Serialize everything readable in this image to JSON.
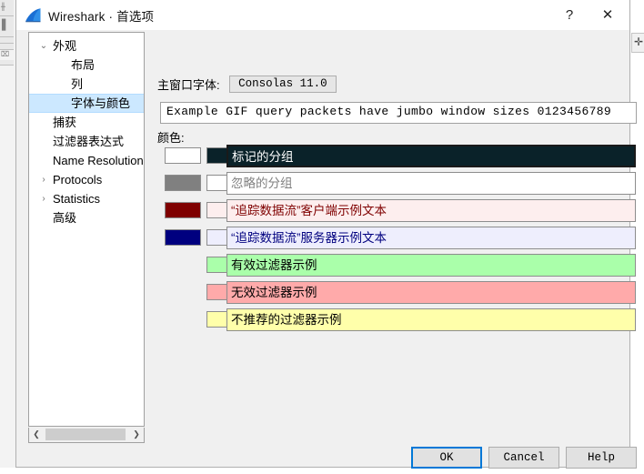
{
  "window": {
    "title": "Wireshark · 首选项",
    "logo_icon": "wireshark-fin-icon",
    "help_button": "?",
    "close_button": "✕"
  },
  "sidebar": {
    "items": [
      {
        "label": "外观",
        "level": 0,
        "twisty": "⌄",
        "selected": false
      },
      {
        "label": "布局",
        "level": 1,
        "twisty": "",
        "selected": false
      },
      {
        "label": "列",
        "level": 1,
        "twisty": "",
        "selected": false
      },
      {
        "label": "字体与颜色",
        "level": 1,
        "twisty": "",
        "selected": true
      },
      {
        "label": "捕获",
        "level": 0,
        "twisty": "",
        "selected": false
      },
      {
        "label": "过滤器表达式",
        "level": 0,
        "twisty": "",
        "selected": false
      },
      {
        "label": "Name Resolution",
        "level": 0,
        "twisty": "",
        "selected": false
      },
      {
        "label": "Protocols",
        "level": 0,
        "twisty": "›",
        "selected": false
      },
      {
        "label": "Statistics",
        "level": 0,
        "twisty": "›",
        "selected": false
      },
      {
        "label": "高级",
        "level": 0,
        "twisty": "",
        "selected": false
      }
    ],
    "scrollbar": {
      "left_arrow": "❮",
      "right_arrow": "❯"
    }
  },
  "main": {
    "font_label": "主窗口字体:",
    "font_value": "Consolas  11.0",
    "sample_text": "Example GIF query packets have jumbo window sizes 0123456789",
    "colors_label": "颜色:",
    "color_rows": [
      {
        "name": "marked-packet",
        "text": "标记的分组",
        "fg": "#ffffff",
        "bg": "#0a2229",
        "has_fg_swatch": true,
        "has_bg_swatch": true,
        "boxed": true
      },
      {
        "name": "ignored-packet",
        "text": "忽略的分组",
        "fg": "#808080",
        "bg": "#ffffff",
        "has_fg_swatch": true,
        "has_bg_swatch": true,
        "boxed": false
      },
      {
        "name": "stream-client",
        "text": "“追踪数据流”客户端示例文本",
        "fg": "#7f0000",
        "bg": "#fdeeee",
        "has_fg_swatch": true,
        "has_bg_swatch": true,
        "boxed": false
      },
      {
        "name": "stream-server",
        "text": "“追踪数据流”服务器示例文本",
        "fg": "#00007f",
        "bg": "#eeeefd",
        "has_fg_swatch": true,
        "has_bg_swatch": true,
        "boxed": false
      },
      {
        "name": "valid-filter",
        "text": "有效过滤器示例",
        "fg": "#000000",
        "bg": "#aaffaa",
        "has_fg_swatch": false,
        "has_bg_swatch": true,
        "boxed": false
      },
      {
        "name": "invalid-filter",
        "text": "无效过滤器示例",
        "fg": "#000000",
        "bg": "#ffaaaa",
        "has_fg_swatch": false,
        "has_bg_swatch": true,
        "boxed": false
      },
      {
        "name": "deprecated-filter",
        "text": "不推荐的过滤器示例",
        "fg": "#000000",
        "bg": "#ffffaa",
        "has_fg_swatch": false,
        "has_bg_swatch": true,
        "boxed": false
      }
    ]
  },
  "buttons": {
    "ok": "OK",
    "cancel": "Cancel",
    "help": "Help"
  },
  "colors": {
    "accent": "#0078d7",
    "selection": "#cce8ff",
    "dialog_bg": "#f0f0f0"
  }
}
